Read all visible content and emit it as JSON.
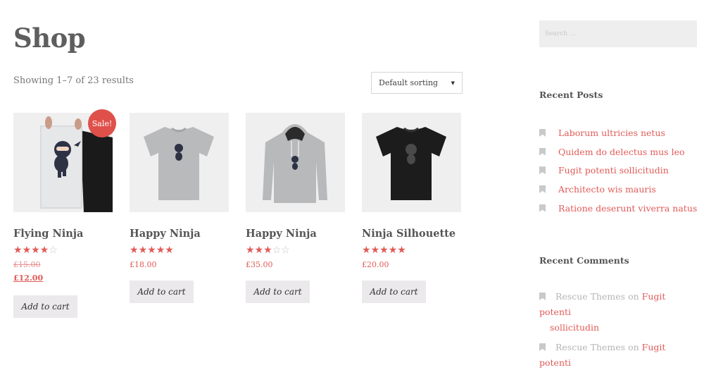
{
  "page": {
    "title": "Shop",
    "result_count": "Showing 1–7 of 23 results",
    "sort_selected": "Default sorting"
  },
  "products": [
    {
      "title": "Flying Ninja",
      "rating": 4,
      "max_rating": 5,
      "old_price": "£15.00",
      "price": "£12.00",
      "sale_badge": "Sale!",
      "cart_label": "Add to cart"
    },
    {
      "title": "Happy Ninja",
      "rating": 5,
      "max_rating": 5,
      "price": "£18.00",
      "cart_label": "Add to cart"
    },
    {
      "title": "Happy Ninja",
      "rating": 3,
      "max_rating": 5,
      "price": "£35.00",
      "cart_label": "Add to cart"
    },
    {
      "title": "Ninja Silhouette",
      "rating": 5,
      "max_rating": 5,
      "price": "£20.00",
      "cart_label": "Add to cart"
    }
  ],
  "sidebar": {
    "search_placeholder": "Search …",
    "recent_posts_title": "Recent Posts",
    "recent_posts": [
      "Laborum ultricies netus",
      "Quidem do delectus mus leo",
      "Fugit potenti sollicitudin",
      "Architecto wis mauris",
      "Ratione deserunt viverra natus"
    ],
    "recent_comments_title": "Recent Comments",
    "recent_comments": [
      {
        "author": "Rescue Themes",
        "on": "on",
        "post_line1": "Fugit potenti",
        "post_line2": "sollicitudin"
      },
      {
        "author": "Rescue Themes",
        "on": "on",
        "post_line1": "Fugit potenti"
      }
    ]
  },
  "colors": {
    "accent": "#e05b58",
    "button_bg": "#ebe9eb",
    "thumb_bg": "#efeff0",
    "badge_bg": "#e0504b"
  }
}
